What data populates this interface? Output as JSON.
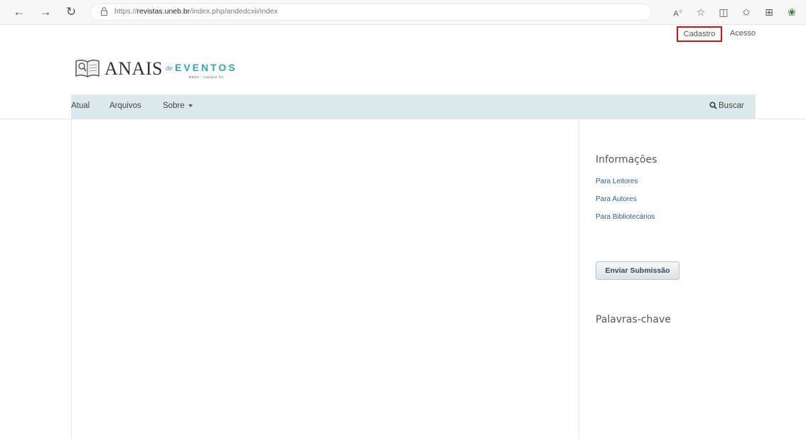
{
  "browser": {
    "url_prefix": "https://",
    "url_domain": "revistas.uneb.br",
    "url_path": "/index.php/andedcxii/index",
    "icons": [
      "back-icon",
      "forward-icon",
      "refresh-icon",
      "lock-icon",
      "read-aloud-icon",
      "favorite-star-icon",
      "split-screen-icon",
      "favorites-icon",
      "collections-icon",
      "extensions-icon"
    ]
  },
  "header": {
    "register_label": "Cadastro",
    "login_label": "Acesso"
  },
  "logo": {
    "main": "ANAIS",
    "de": "de",
    "eventos": "EVENTOS",
    "sub": "DEDC · Campus XII"
  },
  "nav": {
    "items": [
      "Atual",
      "Arquivos",
      "Sobre"
    ],
    "search_label": "Buscar"
  },
  "sidebar": {
    "info_title": "Informações",
    "links": [
      "Para Leitores",
      "Para Autores",
      "Para Bibliotecários"
    ],
    "submit_label": "Enviar Submissão",
    "keywords_title": "Palavras-chave"
  },
  "colors": {
    "nav_bg": "#dce9ea",
    "link": "#2b5f8a",
    "highlight_border": "#e01010",
    "logo_accent": "#2ba7b8"
  }
}
